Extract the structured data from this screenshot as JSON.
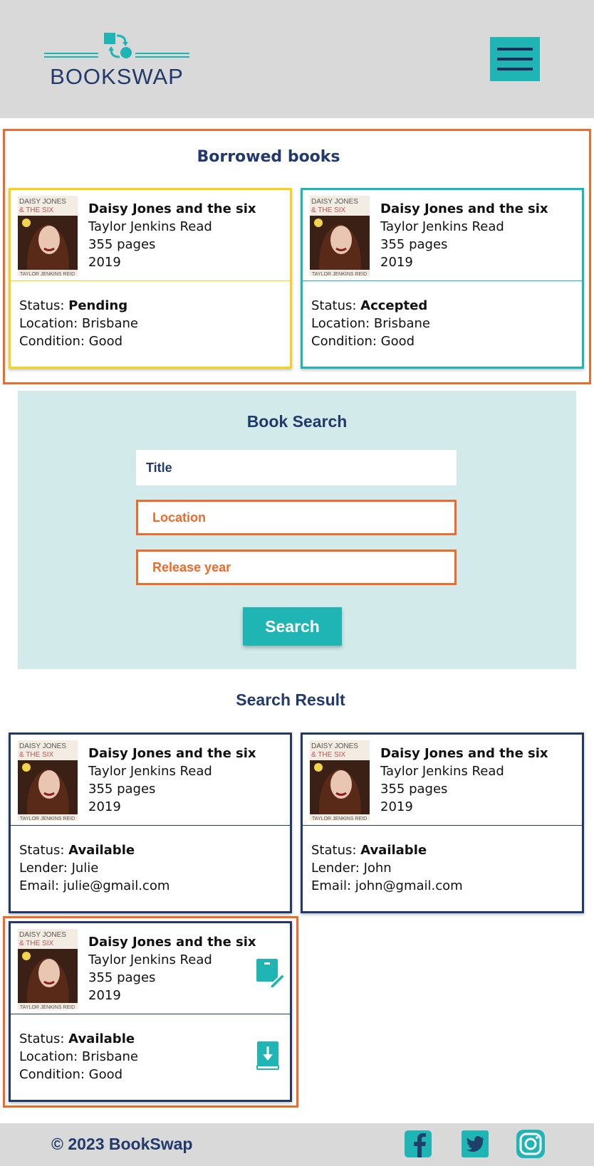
{
  "header": {
    "logo_text": "BOOKSWAP",
    "menu_icon": "hamburger-menu-icon"
  },
  "borrowed": {
    "title": "Borrowed books",
    "cards": [
      {
        "book_title": "Daisy Jones and the six",
        "author": "Taylor Jenkins Read",
        "pages": "355 pages",
        "year": "2019",
        "status_label": "Status: ",
        "status": "Pending",
        "line2": "Location: Brisbane",
        "line3": "Condition: Good",
        "border_color": "#f5d21c"
      },
      {
        "book_title": "Daisy Jones and the six",
        "author": "Taylor Jenkins Read",
        "pages": "355 pages",
        "year": "2019",
        "status_label": "Status: ",
        "status": "Accepted",
        "line2": "Location: Brisbane",
        "line3": "Condition: Good",
        "border_color": "#1fb5b5"
      }
    ]
  },
  "search": {
    "title": "Book Search",
    "title_placeholder": "Title",
    "location_placeholder": "Location",
    "year_placeholder": "Release year",
    "button_label": "Search"
  },
  "results": {
    "title": "Search Result",
    "cards": [
      {
        "book_title": "Daisy Jones and the six",
        "author": "Taylor Jenkins Read",
        "pages": "355 pages",
        "year": "2019",
        "status_label": "Status: ",
        "status": "Available",
        "line2": "Lender: Julie",
        "line3": "Email: julie@gmail.com"
      },
      {
        "book_title": "Daisy Jones and the six",
        "author": "Taylor Jenkins Read",
        "pages": "355 pages",
        "year": "2019",
        "status_label": "Status: ",
        "status": "Available",
        "line2": "Lender: John",
        "line3": "Email: john@gmail.com"
      },
      {
        "book_title": "Daisy Jones and the six",
        "author": "Taylor Jenkins Read",
        "pages": "355 pages",
        "year": "2019",
        "status_label": "Status: ",
        "status": "Available",
        "line2": "Location: Brisbane",
        "line3": "Condition: Good",
        "edit_icon": "edit-book-icon",
        "download_icon": "download-book-icon"
      }
    ]
  },
  "cover": {
    "line1": "DAISY JONES",
    "line2": "& THE SIX",
    "author": "TAYLOR JENKINS REID"
  },
  "footer": {
    "copyright": "© 2023 BookSwap",
    "social_icons": [
      "facebook-icon",
      "twitter-icon",
      "instagram-icon"
    ]
  },
  "colors": {
    "accent": "#1fb5b5",
    "navy": "#223a6b",
    "orange": "#ef6a2b",
    "yellow": "#f5d21c",
    "header_bg": "#d9d9d9",
    "search_bg": "#d3eaea"
  }
}
